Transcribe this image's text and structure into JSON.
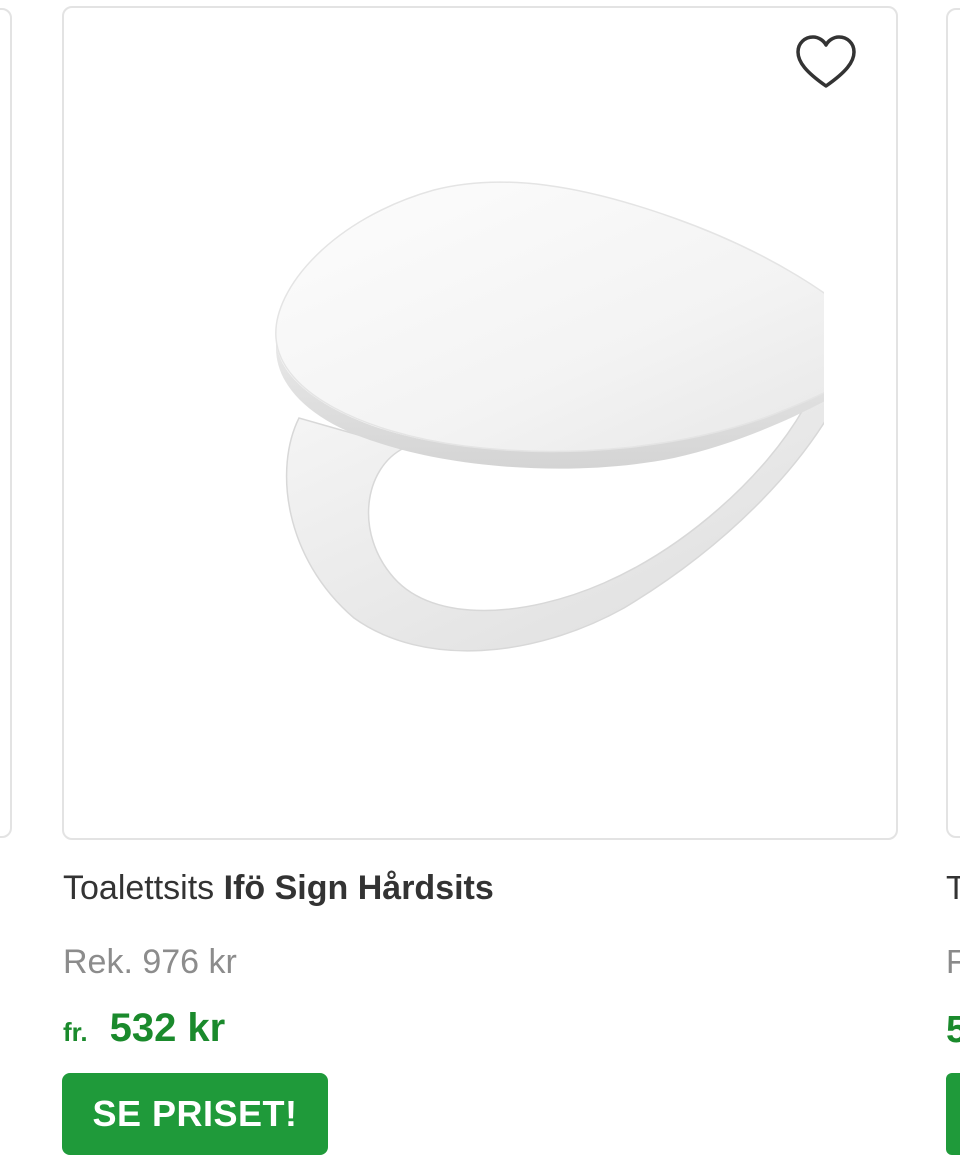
{
  "product": {
    "category": "Toalettsits",
    "name": "Ifö Sign Hårdsits",
    "recommended_price": "Rek. 976 kr",
    "price_prefix": "fr.",
    "price": "532 kr",
    "cta_label": "SE PRISET!"
  },
  "neighbor_right": {
    "title_fragment": "T",
    "rek_fragment": "F",
    "price_fragment": "5"
  },
  "icons": {
    "wishlist": "heart-outline-icon"
  },
  "colors": {
    "accent_green": "#1f9a3a",
    "price_green": "#1a8a2c",
    "border": "#e3e3e3"
  }
}
